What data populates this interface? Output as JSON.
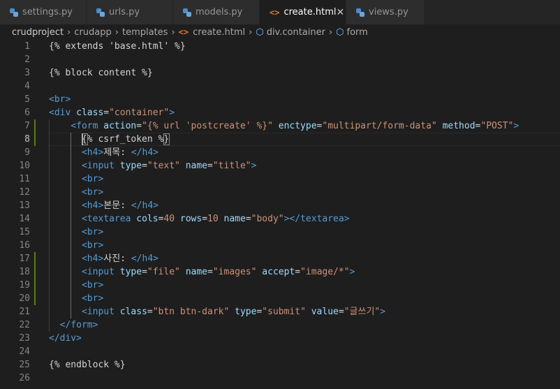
{
  "tabs": [
    {
      "label": "settings.py",
      "icon": "python-file-icon",
      "active": false
    },
    {
      "label": "urls.py",
      "icon": "python-file-icon",
      "active": false
    },
    {
      "label": "models.py",
      "icon": "python-file-icon",
      "active": false
    },
    {
      "label": "create.html",
      "icon": "html-file-icon",
      "active": true
    },
    {
      "label": "views.py",
      "icon": "python-file-icon",
      "active": false
    }
  ],
  "breadcrumb": {
    "items": [
      "crudproject",
      "crudapp",
      "templates",
      "create.html",
      "div.container",
      "form"
    ]
  },
  "code_lines": [
    [
      {
        "t": "txt",
        "v": "{% extends 'base.html' %}"
      }
    ],
    [],
    [
      {
        "t": "txt",
        "v": "{% block content %}"
      }
    ],
    [],
    [
      {
        "t": "tag",
        "v": "<br>"
      }
    ],
    [
      {
        "t": "tag",
        "v": "<div "
      },
      {
        "t": "attr",
        "v": "class"
      },
      {
        "t": "txt",
        "v": "="
      },
      {
        "t": "str",
        "v": "\"container\""
      },
      {
        "t": "tag",
        "v": ">"
      }
    ],
    [
      {
        "t": "txt",
        "v": "    "
      },
      {
        "t": "tag",
        "v": "<form "
      },
      {
        "t": "attr",
        "v": "action"
      },
      {
        "t": "txt",
        "v": "="
      },
      {
        "t": "str",
        "v": "\"{% url 'postcreate' %}\""
      },
      {
        "t": "txt",
        "v": " "
      },
      {
        "t": "attr",
        "v": "enctype"
      },
      {
        "t": "txt",
        "v": "="
      },
      {
        "t": "str",
        "v": "\"multipart/form-data\""
      },
      {
        "t": "txt",
        "v": " "
      },
      {
        "t": "attr",
        "v": "method"
      },
      {
        "t": "txt",
        "v": "="
      },
      {
        "t": "str",
        "v": "\"POST\""
      },
      {
        "t": "tag",
        "v": ">"
      }
    ],
    [
      {
        "t": "txt",
        "v": "      {% csrf_token %}"
      }
    ],
    [
      {
        "t": "txt",
        "v": "      "
      },
      {
        "t": "tag",
        "v": "<h4>"
      },
      {
        "t": "txt",
        "v": "제목: "
      },
      {
        "t": "tag",
        "v": "</h4>"
      }
    ],
    [
      {
        "t": "txt",
        "v": "      "
      },
      {
        "t": "tag",
        "v": "<input "
      },
      {
        "t": "attr",
        "v": "type"
      },
      {
        "t": "txt",
        "v": "="
      },
      {
        "t": "str",
        "v": "\"text\""
      },
      {
        "t": "txt",
        "v": " "
      },
      {
        "t": "attr",
        "v": "name"
      },
      {
        "t": "txt",
        "v": "="
      },
      {
        "t": "str",
        "v": "\"title\""
      },
      {
        "t": "tag",
        "v": ">"
      }
    ],
    [
      {
        "t": "txt",
        "v": "      "
      },
      {
        "t": "tag",
        "v": "<br>"
      }
    ],
    [
      {
        "t": "txt",
        "v": "      "
      },
      {
        "t": "tag",
        "v": "<br>"
      }
    ],
    [
      {
        "t": "txt",
        "v": "      "
      },
      {
        "t": "tag",
        "v": "<h4>"
      },
      {
        "t": "txt",
        "v": "본문: "
      },
      {
        "t": "tag",
        "v": "</h4>"
      }
    ],
    [
      {
        "t": "txt",
        "v": "      "
      },
      {
        "t": "tag",
        "v": "<textarea "
      },
      {
        "t": "attr",
        "v": "cols"
      },
      {
        "t": "txt",
        "v": "="
      },
      {
        "t": "str",
        "v": "40"
      },
      {
        "t": "txt",
        "v": " "
      },
      {
        "t": "attr",
        "v": "rows"
      },
      {
        "t": "txt",
        "v": "="
      },
      {
        "t": "str",
        "v": "10"
      },
      {
        "t": "txt",
        "v": " "
      },
      {
        "t": "attr",
        "v": "name"
      },
      {
        "t": "txt",
        "v": "="
      },
      {
        "t": "str",
        "v": "\"body\""
      },
      {
        "t": "tag",
        "v": "></textarea>"
      }
    ],
    [
      {
        "t": "txt",
        "v": "      "
      },
      {
        "t": "tag",
        "v": "<br>"
      }
    ],
    [
      {
        "t": "txt",
        "v": "      "
      },
      {
        "t": "tag",
        "v": "<br>"
      }
    ],
    [
      {
        "t": "txt",
        "v": "      "
      },
      {
        "t": "tag",
        "v": "<h4>"
      },
      {
        "t": "txt",
        "v": "사진: "
      },
      {
        "t": "tag",
        "v": "</h4>"
      }
    ],
    [
      {
        "t": "txt",
        "v": "      "
      },
      {
        "t": "tag",
        "v": "<input "
      },
      {
        "t": "attr",
        "v": "type"
      },
      {
        "t": "txt",
        "v": "="
      },
      {
        "t": "str",
        "v": "\"file\""
      },
      {
        "t": "txt",
        "v": " "
      },
      {
        "t": "attr",
        "v": "name"
      },
      {
        "t": "txt",
        "v": "="
      },
      {
        "t": "str",
        "v": "\"images\""
      },
      {
        "t": "txt",
        "v": " "
      },
      {
        "t": "attr",
        "v": "accept"
      },
      {
        "t": "txt",
        "v": "="
      },
      {
        "t": "str",
        "v": "\"image/*\""
      },
      {
        "t": "tag",
        "v": ">"
      }
    ],
    [
      {
        "t": "txt",
        "v": "      "
      },
      {
        "t": "tag",
        "v": "<br>"
      }
    ],
    [
      {
        "t": "txt",
        "v": "      "
      },
      {
        "t": "tag",
        "v": "<br>"
      }
    ],
    [
      {
        "t": "txt",
        "v": "      "
      },
      {
        "t": "tag",
        "v": "<input "
      },
      {
        "t": "attr",
        "v": "class"
      },
      {
        "t": "txt",
        "v": "="
      },
      {
        "t": "str",
        "v": "\"btn btn-dark\""
      },
      {
        "t": "txt",
        "v": " "
      },
      {
        "t": "attr",
        "v": "type"
      },
      {
        "t": "txt",
        "v": "="
      },
      {
        "t": "str",
        "v": "\"submit\""
      },
      {
        "t": "txt",
        "v": " "
      },
      {
        "t": "attr",
        "v": "value"
      },
      {
        "t": "txt",
        "v": "="
      },
      {
        "t": "str",
        "v": "\"글쓰기\""
      },
      {
        "t": "tag",
        "v": ">"
      }
    ],
    [
      {
        "t": "txt",
        "v": "  "
      },
      {
        "t": "tag",
        "v": "</form>"
      }
    ],
    [
      {
        "t": "tag",
        "v": "</div>"
      }
    ],
    [],
    [
      {
        "t": "txt",
        "v": "{% endblock %}"
      }
    ],
    []
  ],
  "colors": {
    "tag": "#569cd6",
    "attr": "#9cdcfe",
    "str": "#ce9178",
    "txt": "#d4d4d4"
  }
}
